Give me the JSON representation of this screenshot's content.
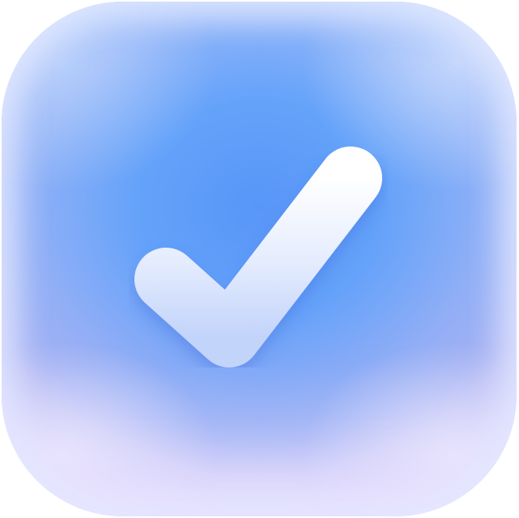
{
  "icon": {
    "name": "checkmark-icon",
    "colors": {
      "tile_center": "#5896f8",
      "tile_edge": "#a9c6fb",
      "tile_bottom": "#d9d6fb",
      "check_top": "#ffffff",
      "check_bottom": "#c3d4fb"
    }
  }
}
